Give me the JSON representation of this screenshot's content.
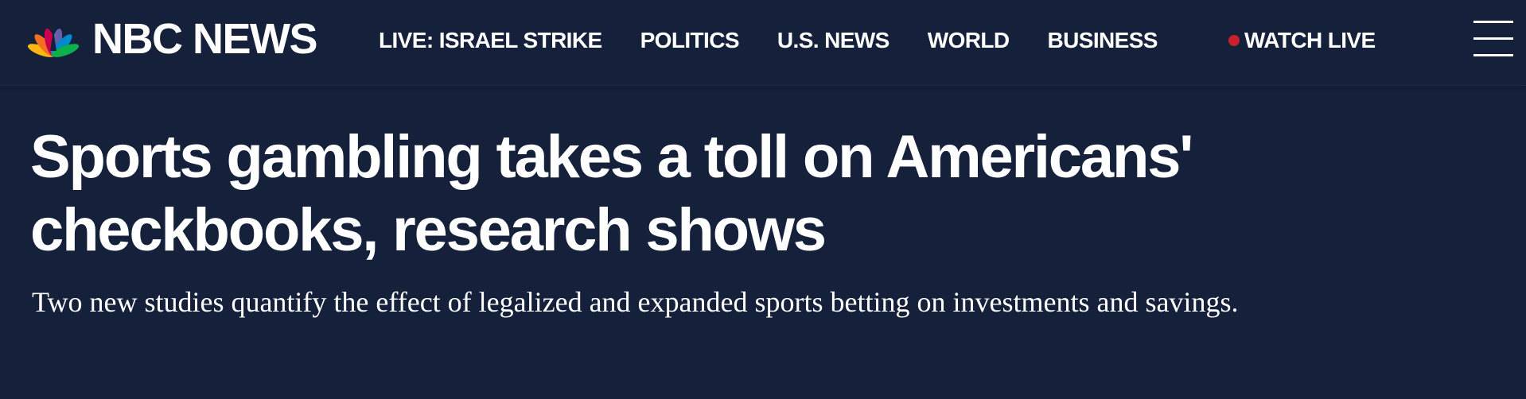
{
  "brand": {
    "name": "NBC NEWS",
    "peacock_colors": [
      "#fcb711",
      "#f37021",
      "#cc004c",
      "#6460aa",
      "#0089d0",
      "#0db14b"
    ]
  },
  "nav": {
    "items": [
      {
        "label": "LIVE: ISRAEL STRIKE"
      },
      {
        "label": "POLITICS"
      },
      {
        "label": "U.S. NEWS"
      },
      {
        "label": "WORLD"
      },
      {
        "label": "BUSINESS"
      }
    ],
    "watch_live": {
      "label": "WATCH LIVE",
      "dot_color": "#c9202e"
    },
    "menu_icon": "hamburger-menu-icon"
  },
  "article": {
    "headline_line1": "Sports gambling takes a toll on Americans'",
    "headline_line2": "checkbooks, research shows",
    "dek": "Two new studies quantify the effect of legalized and expanded sports betting on investments and savings."
  },
  "colors": {
    "background": "#15203a",
    "text": "#ffffff"
  }
}
